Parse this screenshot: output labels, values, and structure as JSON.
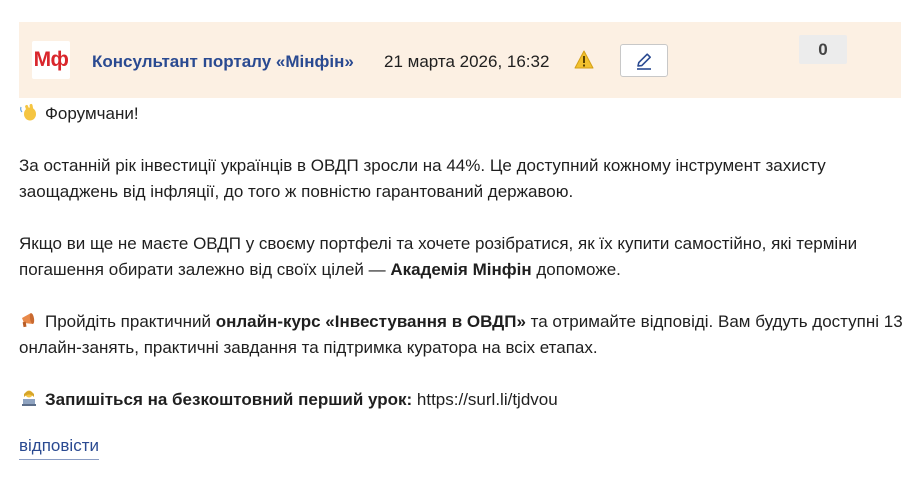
{
  "header": {
    "logo_text": "Мф",
    "author": "Консультант порталу «Мінфін»",
    "date": "21 марта 2026, 16:32",
    "score": "0",
    "icons": {
      "warning": "warning-icon",
      "edit": "pencil-icon"
    },
    "colors": {
      "header_bg": "#fcf0e3",
      "author": "#2a4a91",
      "logo": "#d9262c"
    }
  },
  "post": {
    "greeting": "Форумчани!",
    "p1": "За останній рік інвестиції українців в ОВДП зросли на 44%. Це доступний кожному інструмент захисту заощаджень від інфляції, до того ж повністю гарантований державою.",
    "p2_before": "Якщо ви ще не маєте ОВДП у своєму портфелі та хочете розібратися, як їх купити самостійно, які терміни погашення обирати залежно від своїх цілей — ",
    "p2_bold": "Академія Мінфін",
    "p2_after": " допоможе.",
    "p3_before": "Пройдіть практичний ",
    "p3_bold": "онлайн-курс «Інвестування в ОВДП»",
    "p3_after": " та отримайте відповіді. Вам будуть доступні 13 онлайн-занять, практичні завдання та підтримка куратора на всіх етапах.",
    "p4_bold": "Запишіться на безкоштовний перший урок:",
    "p4_link": " https://surl.li/tjdvou",
    "icons": [
      "waving-hand-icon",
      "megaphone-icon",
      "person-at-laptop-icon"
    ]
  },
  "reply_label": "відповісти"
}
